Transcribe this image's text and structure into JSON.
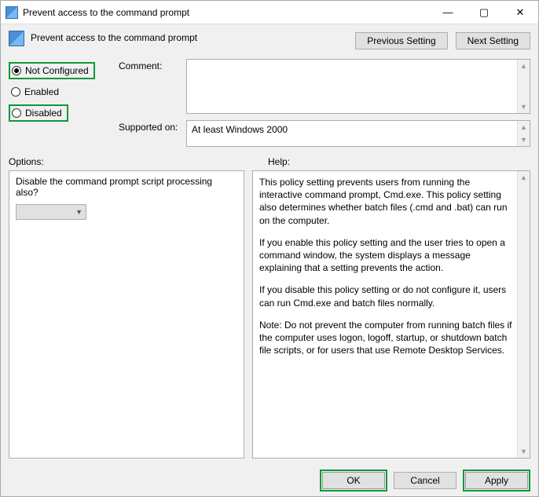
{
  "titlebar": {
    "title": "Prevent access to the command prompt"
  },
  "header": {
    "title": "Prevent access to the command prompt",
    "prev_btn": "Previous Setting",
    "next_btn": "Next Setting"
  },
  "radios": {
    "not_configured": "Not Configured",
    "enabled": "Enabled",
    "disabled": "Disabled"
  },
  "fields": {
    "comment_label": "Comment:",
    "supported_label": "Supported on:",
    "supported_value": "At least Windows 2000"
  },
  "sections": {
    "options_label": "Options:",
    "help_label": "Help:"
  },
  "options": {
    "question": "Disable the command prompt script processing also?"
  },
  "help": {
    "p1": "This policy setting prevents users from running the interactive command prompt, Cmd.exe.  This policy setting also determines whether batch files (.cmd and .bat) can run on the computer.",
    "p2": "If you enable this policy setting and the user tries to open a command window, the system displays a message explaining that a setting prevents the action.",
    "p3": "If you disable this policy setting or do not configure it, users can run Cmd.exe and batch files normally.",
    "p4": "Note: Do not prevent the computer from running batch files if the computer uses logon, logoff, startup, or shutdown batch file scripts, or for users that use Remote Desktop Services."
  },
  "footer": {
    "ok": "OK",
    "cancel": "Cancel",
    "apply": "Apply"
  }
}
